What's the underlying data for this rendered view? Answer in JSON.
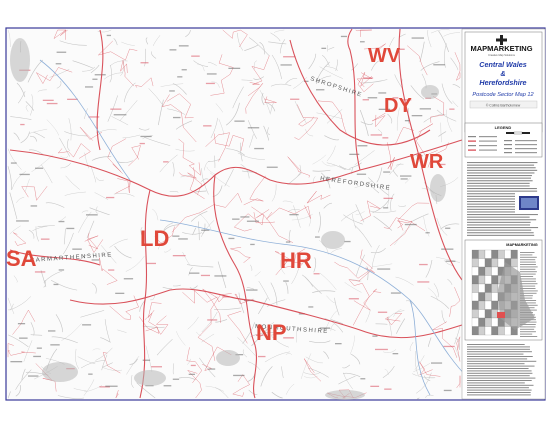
{
  "title_panel": {
    "brand": "MAPMARKETING",
    "brand_tagline": "Creative Map Solutions",
    "title_line1": "Central Wales",
    "title_amp": "&",
    "title_line2": "Herefordshire",
    "subtitle": "Postcode Sector Map 12",
    "copyright": "© Collins Bartholomew"
  },
  "legend": {
    "heading": "LEGEND"
  },
  "postcode_areas": [
    {
      "code": "WV",
      "color": "#e0483a"
    },
    {
      "code": "DY",
      "color": "#e0483a"
    },
    {
      "code": "WR",
      "color": "#e0483a"
    },
    {
      "code": "LD",
      "color": "#e0483a"
    },
    {
      "code": "HR",
      "color": "#e0483a"
    },
    {
      "code": "NP",
      "color": "#e0483a"
    },
    {
      "code": "SA",
      "color": "#e0483a"
    }
  ],
  "county_labels": [
    {
      "name": "SHROPSHIRE"
    },
    {
      "name": "HEREFORDSHIRE"
    },
    {
      "name": "CARMARTHENSHIRE"
    },
    {
      "name": "MONMOUTHSHIRE"
    }
  ],
  "index_panel": {
    "heading": "MAPMARKETING"
  },
  "colors": {
    "boundary": "#d6404a",
    "road": "#c8c8c8",
    "frame": "#3a3a9a",
    "map_bg": "#fbfbfb",
    "area_label": "#e0483a",
    "title_blue": "#1f3aa8"
  }
}
